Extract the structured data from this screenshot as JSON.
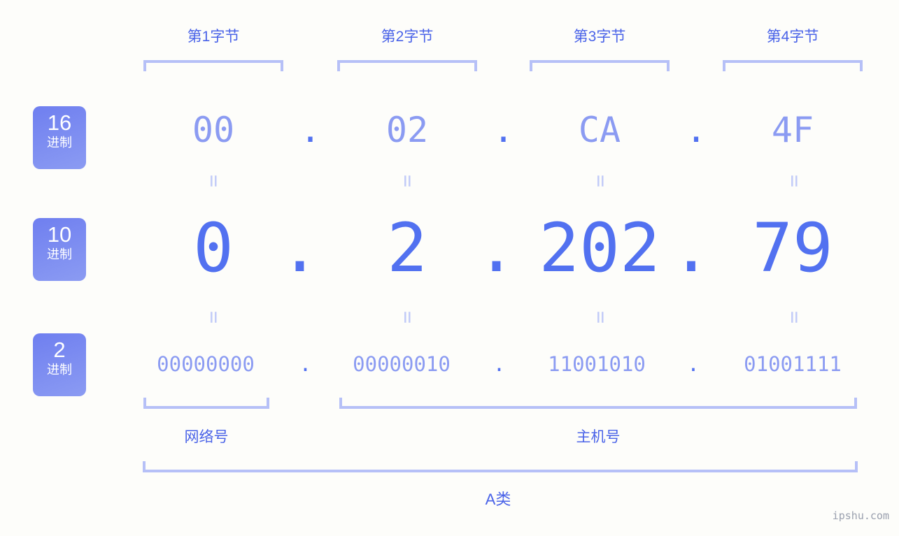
{
  "meta": {
    "background_color": "#fdfdfa",
    "accent_strong": "#5271f0",
    "accent_light": "#8b9bf2",
    "bracket_color": "#b6c0f7",
    "label_color": "#4a63e8",
    "badge_text_color": "#ffffff",
    "watermark": "ipshu.com"
  },
  "byte_headers": [
    {
      "label": "第1字节"
    },
    {
      "label": "第2字节"
    },
    {
      "label": "第3字节"
    },
    {
      "label": "第4字节"
    }
  ],
  "bases": [
    {
      "num": "16",
      "unit": "进制"
    },
    {
      "num": "10",
      "unit": "进制"
    },
    {
      "num": "2",
      "unit": "进制"
    }
  ],
  "separator": ".",
  "equals_glyph": "=",
  "rows": {
    "hex": {
      "base_num": "16",
      "base_unit": "进制",
      "octets": [
        "00",
        "02",
        "CA",
        "4F"
      ]
    },
    "dec": {
      "base_num": "10",
      "base_unit": "进制",
      "octets": [
        "0",
        "2",
        "202",
        "79"
      ]
    },
    "bin": {
      "base_num": "2",
      "base_unit": "进制",
      "octets": [
        "00000000",
        "00000010",
        "11001010",
        "01001111"
      ]
    }
  },
  "address": {
    "decimal": "0.2.202.79",
    "hex": "00.02.CA.4F",
    "binary": "00000000.00000010.11001010.01001111"
  },
  "sections": {
    "network": "网络号",
    "host": "主机号",
    "class": "A类"
  }
}
